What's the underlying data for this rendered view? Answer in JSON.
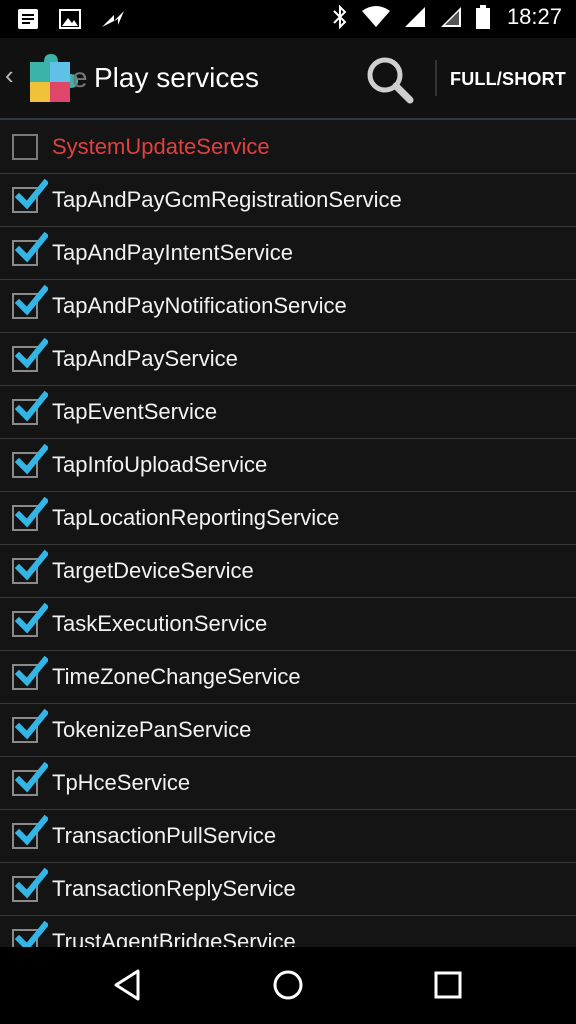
{
  "status_bar": {
    "time": "18:27",
    "notification_icons": [
      "document-icon",
      "image-icon",
      "lightning-icon"
    ],
    "system_icons": [
      "bluetooth-icon",
      "wifi-icon",
      "signal-icon",
      "signal-icon",
      "battery-icon"
    ]
  },
  "action_bar": {
    "title": "Play services",
    "title_fade": "e",
    "full_short_label": "FULL/SHORT"
  },
  "services": [
    {
      "name": "SystemUpdateService",
      "checked": false,
      "disabled": true
    },
    {
      "name": "TapAndPayGcmRegistrationService",
      "checked": true,
      "disabled": false
    },
    {
      "name": "TapAndPayIntentService",
      "checked": true,
      "disabled": false
    },
    {
      "name": "TapAndPayNotificationService",
      "checked": true,
      "disabled": false
    },
    {
      "name": "TapAndPayService",
      "checked": true,
      "disabled": false
    },
    {
      "name": "TapEventService",
      "checked": true,
      "disabled": false
    },
    {
      "name": "TapInfoUploadService",
      "checked": true,
      "disabled": false
    },
    {
      "name": "TapLocationReportingService",
      "checked": true,
      "disabled": false
    },
    {
      "name": "TargetDeviceService",
      "checked": true,
      "disabled": false
    },
    {
      "name": "TaskExecutionService",
      "checked": true,
      "disabled": false
    },
    {
      "name": "TimeZoneChangeService",
      "checked": true,
      "disabled": false
    },
    {
      "name": "TokenizePanService",
      "checked": true,
      "disabled": false
    },
    {
      "name": "TpHceService",
      "checked": true,
      "disabled": false
    },
    {
      "name": "TransactionPullService",
      "checked": true,
      "disabled": false
    },
    {
      "name": "TransactionReplyService",
      "checked": true,
      "disabled": false
    },
    {
      "name": "TrustAgentBridgeService",
      "checked": true,
      "disabled": false
    }
  ],
  "colors": {
    "accent_check": "#33b5e5",
    "disabled_text": "#e04040",
    "background": "#141414"
  }
}
